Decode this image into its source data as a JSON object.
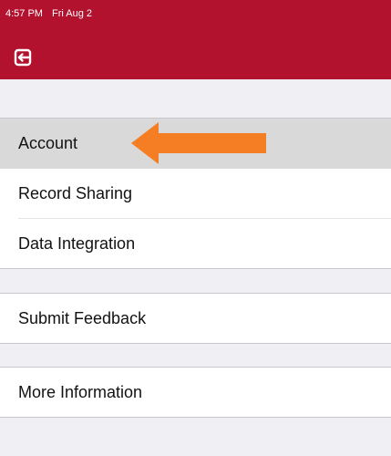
{
  "status_bar": {
    "time": "4:57 PM",
    "date": "Fri Aug 2"
  },
  "header": {
    "background_color": "#b2122e",
    "back_icon": "exit-icon"
  },
  "menu": {
    "items": [
      {
        "label": "Account",
        "selected": true
      },
      {
        "label": "Record Sharing",
        "selected": false
      },
      {
        "label": "Data Integration",
        "selected": false
      },
      {
        "label": "Submit Feedback",
        "selected": false
      },
      {
        "label": "More Information",
        "selected": false
      }
    ]
  },
  "annotation": {
    "arrow_color": "#f57e24",
    "points_to": "Account"
  }
}
